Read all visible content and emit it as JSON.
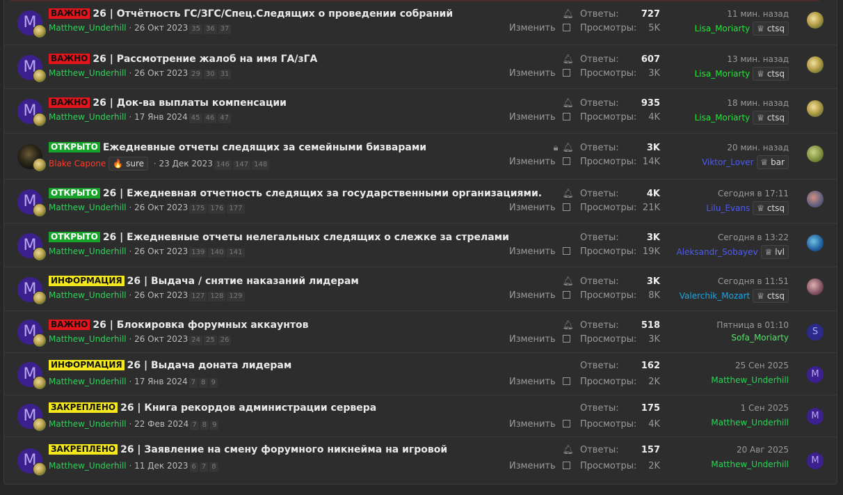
{
  "labels": {
    "replies": "Ответы:",
    "views": "Просмотры:",
    "change": "Изменить"
  },
  "threads": [
    {
      "prefix": "ВАЖНО",
      "prefix_color": "#e3151a",
      "title": "26 | Отчётность ГС/ЗГС/Спец.Следящих о проведении собраний",
      "author": "Matthew_Underhill",
      "date": "26 Окт 2023",
      "pages": [
        "35",
        "36",
        "37"
      ],
      "replies": "727",
      "views": "5K",
      "last_time": "11 мин. назад",
      "last_user": "Lisa_Moriarty",
      "last_badge": "ctsq",
      "avatar_letter": "M",
      "bell": true,
      "lock": false
    },
    {
      "prefix": "ВАЖНО",
      "prefix_color": "#e3151a",
      "title": "26 | Рассмотрение жалоб на имя ГА/зГА",
      "author": "Matthew_Underhill",
      "date": "26 Окт 2023",
      "pages": [
        "29",
        "30",
        "31"
      ],
      "replies": "607",
      "views": "3K",
      "last_time": "13 мин. назад",
      "last_user": "Lisa_Moriarty",
      "last_badge": "ctsq",
      "avatar_letter": "M",
      "bell": true,
      "lock": false
    },
    {
      "prefix": "ВАЖНО",
      "prefix_color": "#e3151a",
      "title": "26 | Док-ва выплаты компенсации",
      "author": "Matthew_Underhill",
      "date": "17 Янв 2024",
      "pages": [
        "45",
        "46",
        "47"
      ],
      "replies": "935",
      "views": "4K",
      "last_time": "18 мин. назад",
      "last_user": "Lisa_Moriarty",
      "last_badge": "ctsq",
      "avatar_letter": "M",
      "bell": true,
      "lock": false
    },
    {
      "prefix": "ОТКРЫТО",
      "prefix_color": "#16a52a",
      "title": "Ежедневные отчеты следящих за семейными бизварами",
      "author": "Blake Capone",
      "author_badge": "sure",
      "date": "23 Дек 2023",
      "pages": [
        "146",
        "147",
        "148"
      ],
      "replies": "3K",
      "views": "14K",
      "last_time": "20 мин. назад",
      "last_user": "Viktor_Lover",
      "last_badge": "bar",
      "avatar_letter": "",
      "bell": true,
      "lock": true
    },
    {
      "prefix": "ОТКРЫТО",
      "prefix_color": "#16a52a",
      "title": "26 | Ежедневная отчетность следящих за государственными организациями.",
      "author": "Matthew_Underhill",
      "date": "26 Окт 2023",
      "pages": [
        "175",
        "176",
        "177"
      ],
      "replies": "4K",
      "views": "21K",
      "last_time": "Сегодня в 17:11",
      "last_user": "Lilu_Evans",
      "last_badge": "ctsq",
      "avatar_letter": "M",
      "bell": true,
      "lock": false
    },
    {
      "prefix": "ОТКРЫТО",
      "prefix_color": "#16a52a",
      "title": "26 | Ежедневные отчеты нелегальных следящих о слежке за стрелами",
      "author": "Matthew_Underhill",
      "date": "26 Окт 2023",
      "pages": [
        "139",
        "140",
        "141"
      ],
      "replies": "3K",
      "views": "19K",
      "last_time": "Сегодня в 13:22",
      "last_user": "Aleksandr_Sobayev",
      "last_badge": "lvl",
      "avatar_letter": "M",
      "bell": false,
      "lock": false
    },
    {
      "prefix": "ИНФОРМАЦИЯ",
      "prefix_color": "#f4e81a",
      "title": "26 | Выдача / снятие наказаний лидерам",
      "author": "Matthew_Underhill",
      "date": "26 Окт 2023",
      "pages": [
        "127",
        "128",
        "129"
      ],
      "replies": "3K",
      "views": "8K",
      "last_time": "Сегодня в 11:51",
      "last_user": "Valerchik_Mozart",
      "last_badge": "ctsq",
      "avatar_letter": "M",
      "bell": true,
      "lock": false
    },
    {
      "prefix": "ВАЖНО",
      "prefix_color": "#e3151a",
      "title": "26 | Блокировка форумных аккаунтов",
      "author": "Matthew_Underhill",
      "date": "26 Окт 2023",
      "pages": [
        "24",
        "25",
        "26"
      ],
      "replies": "518",
      "views": "3K",
      "last_time": "Пятница в 01:10",
      "last_user": "Sofa_Moriarty",
      "last_badge": "",
      "avatar_letter": "M",
      "last_avatar": "S",
      "bell": true,
      "lock": false
    },
    {
      "prefix": "ИНФОРМАЦИЯ",
      "prefix_color": "#f4e81a",
      "title": "26 | Выдача доната лидерам",
      "author": "Matthew_Underhill",
      "date": "17 Янв 2024",
      "pages": [
        "7",
        "8",
        "9"
      ],
      "replies": "162",
      "views": "2K",
      "last_time": "25 Сен 2025",
      "last_user": "Matthew_Underhill",
      "last_badge": "",
      "avatar_letter": "M",
      "last_avatar": "M",
      "bell": false,
      "lock": false
    },
    {
      "prefix": "ЗАКРЕПЛЕНО",
      "prefix_color": "#f4e81a",
      "title": "26 | Книга рекордов администрации сервера",
      "author": "Matthew_Underhill",
      "date": "22 Фев 2024",
      "pages": [
        "7",
        "8",
        "9"
      ],
      "replies": "175",
      "views": "4K",
      "last_time": "1 Сен 2025",
      "last_user": "Matthew_Underhill",
      "last_badge": "",
      "avatar_letter": "M",
      "last_avatar": "M",
      "bell": false,
      "lock": false
    },
    {
      "prefix": "ЗАКРЕПЛЕНО",
      "prefix_color": "#f4e81a",
      "title": "26 | Заявление на смену форумного никнейма на игровой",
      "author": "Matthew_Underhill",
      "date": "11 Дек 2023",
      "pages": [
        "6",
        "7",
        "8"
      ],
      "replies": "157",
      "views": "2K",
      "last_time": "20 Авг 2025",
      "last_user": "Matthew_Underhill",
      "last_badge": "",
      "avatar_letter": "M",
      "last_avatar": "M",
      "bell": true,
      "lock": false
    }
  ]
}
